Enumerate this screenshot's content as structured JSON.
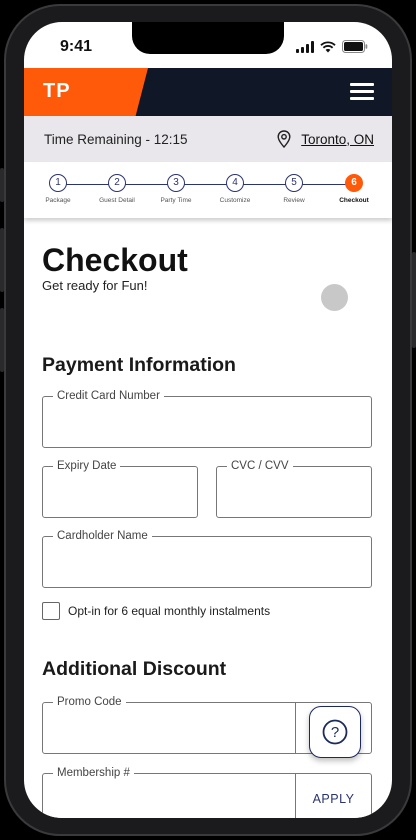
{
  "status": {
    "time": "9:41"
  },
  "header": {
    "brand": "TP"
  },
  "timebar": {
    "time_remaining": "Time Remaining - 12:15",
    "location": "Toronto, ON"
  },
  "steps": [
    {
      "num": "1",
      "label": "Package"
    },
    {
      "num": "2",
      "label": "Guest Detail"
    },
    {
      "num": "3",
      "label": "Party Time"
    },
    {
      "num": "4",
      "label": "Customize"
    },
    {
      "num": "5",
      "label": "Review"
    },
    {
      "num": "6",
      "label": "Checkout"
    }
  ],
  "active_step": 6,
  "page": {
    "title": "Checkout",
    "subtitle": "Get ready for Fun!"
  },
  "payment": {
    "heading": "Payment Information",
    "card_number_label": "Credit Card Number",
    "expiry_label": "Expiry Date",
    "cvc_label": "CVC / CVV",
    "cardholder_label": "Cardholder Name",
    "installments_label": "Opt-in for 6 equal monthly instalments"
  },
  "discount": {
    "heading": "Additional Discount",
    "promo_label": "Promo Code",
    "membership_label": "Membership #",
    "apply_label": "APPLY"
  },
  "help": {
    "icon": "?"
  },
  "colors": {
    "brand_orange": "#ff5a0a",
    "navy": "#101828",
    "step_blue": "#2a3470"
  }
}
